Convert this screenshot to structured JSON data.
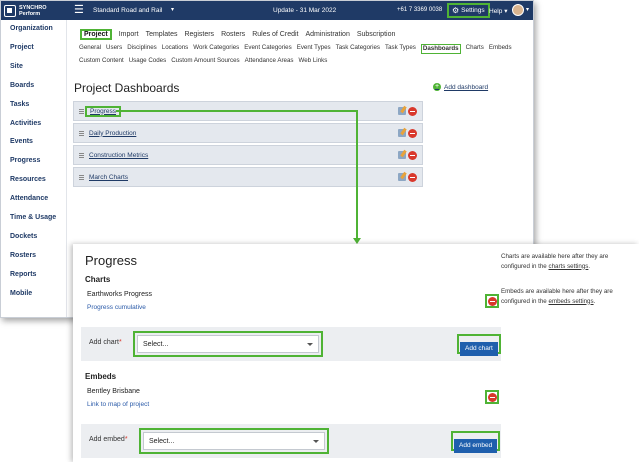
{
  "topbar": {
    "logo_line1": "SYNCHRO",
    "logo_line2": "Perform",
    "project_name": "Standard Road and Rail",
    "update_text": "Update - 31 Mar 2022",
    "phone": "+61 7 3369 0038",
    "settings_label": "Settings",
    "help_label": "Help",
    "caret": "▾",
    "hamburger": "☰",
    "gear": "⚙"
  },
  "sidebar": {
    "items": [
      "Organization",
      "Project",
      "Site",
      "Boards",
      "Tasks",
      "Activities",
      "Events",
      "Progress",
      "Resources",
      "Attendance",
      "Time & Usage",
      "Dockets",
      "Rosters",
      "Reports",
      "Mobile"
    ]
  },
  "main_nav": {
    "tabs": [
      "Project",
      "Import",
      "Templates",
      "Registers",
      "Rosters",
      "Rules of Credit",
      "Administration",
      "Subscription"
    ]
  },
  "sub_nav": {
    "tabs": [
      "General",
      "Users",
      "Disciplines",
      "Locations",
      "Work Categories",
      "Event Categories",
      "Event Types",
      "Task Categories",
      "Task Types",
      "Dashboards",
      "Charts",
      "Embeds",
      "Custom Content",
      "Usage Codes",
      "Custom Amount Sources",
      "Attendance Areas",
      "Web Links"
    ]
  },
  "dashboards": {
    "title": "Project Dashboards",
    "add_label": "Add dashboard",
    "add_icon": "+",
    "rows": [
      "Progress",
      "Daily Production",
      "Construction Metrics",
      "March Charts"
    ]
  },
  "detail": {
    "title": "Progress",
    "charts_heading": "Charts",
    "chart_item_title": "Earthworks Progress",
    "chart_item_link": "Progress cumulative",
    "add_chart_label": "Add chart",
    "add_chart_placeholder": "Select...",
    "add_chart_button": "Add chart",
    "embeds_heading": "Embeds",
    "embed_item_title": "Bentley Brisbane",
    "embed_item_link": "Link to map of project",
    "add_embed_label": "Add embed",
    "add_embed_placeholder": "Select...",
    "add_embed_button": "Add embed",
    "required_marker": "*",
    "charts_note_pre": "Charts are available here after they are configured in the",
    "charts_note_link": "charts settings",
    "embeds_note_pre": "Embeds are available here after they are configured in the",
    "embeds_note_link": "embeds settings",
    "note_end": "."
  },
  "colors": {
    "header_bg": "#1f3a66",
    "highlight": "#4fb335",
    "danger": "#d9382c",
    "primary_button": "#1f5fad"
  }
}
